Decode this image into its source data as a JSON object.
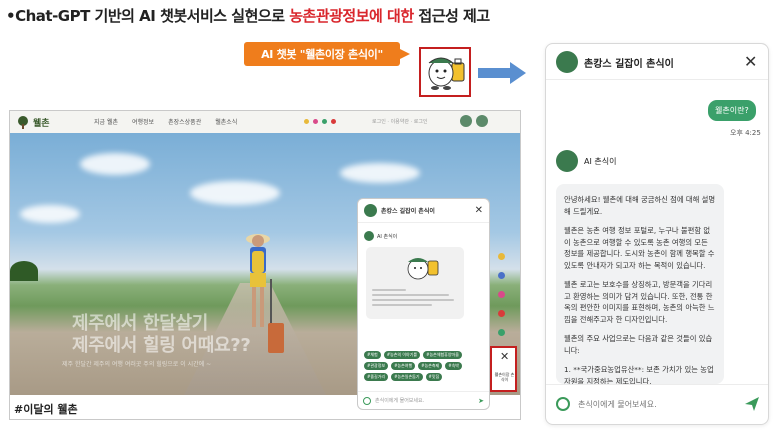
{
  "heading": {
    "prefix": "•Chat-GPT 기반의 AI 챗봇서비스 실현으로 ",
    "highlight": "농촌관광정보에 대한",
    "suffix": " 접근성 제고"
  },
  "callout": {
    "label": "AI 챗봇 \"웰촌이장 촌식이\""
  },
  "site": {
    "logo": "웰촌",
    "nav": [
      "지금 웰촌",
      "여행정보",
      "촌장스상품관",
      "웰촌소식"
    ],
    "login": "로그인 · 이용약관 · 로그인",
    "hero_line1": "제주에서 한달살기",
    "hero_line2": "제주에서 힐링 어때요??",
    "hero_line3": "제주 한달간 제주의 여행 여러곳 주의 힐링으로 이 시간에 ~",
    "bottom": "#이달의 웰촌",
    "mini_chat": {
      "title": "촌캉스 길잡이 촌식이",
      "bot_name": "AI 촌식이",
      "chips": [
        "#체험",
        "#농촌의 이야기를",
        "#농촌체험휴양마을",
        "#관광정보",
        "#농촌여행",
        "#농촌축제",
        "#숙박",
        "#즐길거리",
        "#농촌일손돕기",
        "#맛집"
      ],
      "placeholder": "촌식이에게 물어보세요."
    },
    "float_label": "웰촌이장 촌식이",
    "side_colors": [
      "#e8b93a",
      "#4a70c8",
      "#d94a8a",
      "#d93a3a",
      "#3aa06a"
    ]
  },
  "chat": {
    "title": "촌캉스 길잡이 촌식이",
    "user_message": "웰촌이란?",
    "time": "오후 4:25",
    "bot_name": "AI 촌식이",
    "bot_paragraphs": [
      "안녕하세요! 웰촌에 대해 궁금하신 점에 대해 설명해 드릴게요.",
      "웰촌은 농촌 여행 정보 포털로, 누구나 불편함 없이 농촌으로 여행할 수 있도록 농촌 여행의 모든 정보를 제공합니다. 도시와 농촌이 함께 행복할 수 있도록 안내자가 되고자 하는 목적이 있습니다.",
      "웰촌 로고는 보호수를 상징하고, 방문객을 기다리고 환영하는 의미가 담겨 있습니다. 또한, 전통 한옥의 편안한 이미지를 표현하며, 농촌의 아늑한 느낌을 전해주고자 한 디자인입니다.",
      "웰촌의 주요 사업으로는 다음과 같은 것들이 있습니다:",
      "1. **국가중요농업유산**: 보존 가치가 있는 농업 자원을 지정하는 제도입니다."
    ],
    "placeholder": "촌식이에게 물어보세요."
  },
  "colors": {
    "accent_red": "#d9262c",
    "callout_orange": "#ef7d1c",
    "brand_green": "#3aa06a",
    "arrow_blue": "#5a8fd0"
  }
}
